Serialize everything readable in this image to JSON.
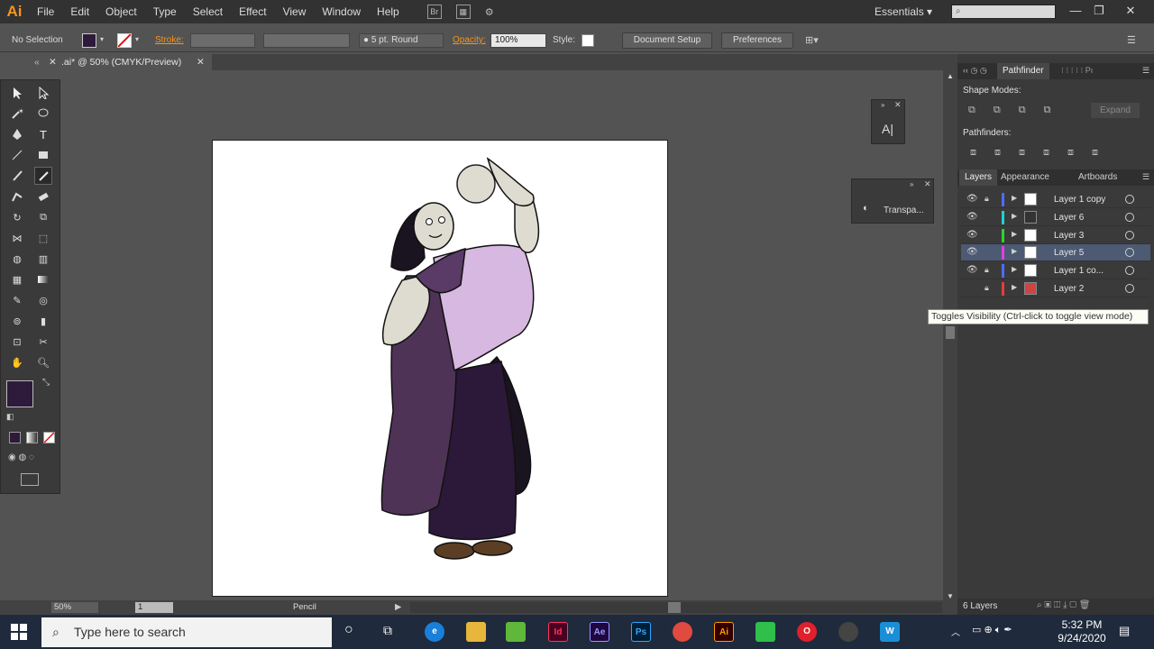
{
  "app": {
    "logo": "Ai",
    "workspace": "Essentials",
    "search_placeholder": ""
  },
  "menu": [
    "File",
    "Edit",
    "Object",
    "Type",
    "Select",
    "Effect",
    "View",
    "Window",
    "Help"
  ],
  "menu_extra": {
    "bridge": "Br"
  },
  "control_bar": {
    "selection": "No Selection",
    "stroke_label": "Stroke:",
    "brush_label": "5 pt. Round",
    "opacity_label": "Opacity:",
    "opacity_value": "100%",
    "style_label": "Style:",
    "document_setup": "Document Setup",
    "preferences": "Preferences"
  },
  "document": {
    "tab_title": ".ai* @ 50% (CMYK/Preview)"
  },
  "status_bar": {
    "zoom": "50%",
    "artboard": "1",
    "tool": "Pencil"
  },
  "pathfinder": {
    "tabs": [
      "Pathfinder"
    ],
    "shape_modes": "Shape Modes:",
    "pathfinders": "Pathfinders:",
    "expand": "Expand"
  },
  "floating": {
    "char_label": "A|",
    "transparency": "Transpa..."
  },
  "layers_panel": {
    "tabs": [
      "Layers",
      "Appearance",
      "Artboards"
    ],
    "layers": [
      {
        "name": "Layer 1 copy",
        "color": "#4f6bff",
        "locked": true,
        "visible": true,
        "selected": false
      },
      {
        "name": "Layer 6",
        "color": "#21d0d0",
        "locked": false,
        "visible": true,
        "selected": false
      },
      {
        "name": "Layer 3",
        "color": "#2fd22f",
        "locked": false,
        "visible": true,
        "selected": false
      },
      {
        "name": "Layer 5",
        "color": "#e040e0",
        "locked": false,
        "visible": true,
        "selected": true
      },
      {
        "name": "Layer 1 co...",
        "color": "#4f6bff",
        "locked": true,
        "visible": true,
        "selected": false
      },
      {
        "name": "Layer 2",
        "color": "#e83b3b",
        "locked": true,
        "visible": false,
        "selected": false
      }
    ],
    "count": "6 Layers"
  },
  "tooltip": "Toggles Visibility (Ctrl-click to toggle view mode)",
  "taskbar": {
    "search_placeholder": "Type here to search",
    "time": "5:32 PM",
    "date": "9/24/2020"
  },
  "colors": {
    "fill": "#2e1a3a",
    "accent": "#f7941e",
    "selected_layer": "#4d5a73"
  }
}
